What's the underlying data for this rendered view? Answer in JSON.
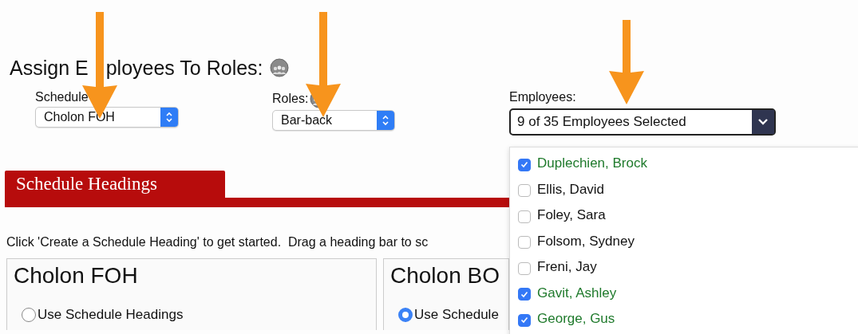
{
  "title": [
    "Assign E",
    "ployees To Roles:"
  ],
  "schedule": {
    "label": "Schedule",
    "value": "Cholon FOH"
  },
  "roles": {
    "label": "Roles:",
    "value": "Bar-back"
  },
  "employees": {
    "label": "Employees:",
    "value": "9 of 35 Employees Selected",
    "expanded": true,
    "options": [
      {
        "name": "Duplechien, Brock",
        "checked": true
      },
      {
        "name": "Ellis, David",
        "checked": false
      },
      {
        "name": "Foley, Sara",
        "checked": false
      },
      {
        "name": "Folsom, Sydney",
        "checked": false
      },
      {
        "name": "Freni, Jay",
        "checked": false
      },
      {
        "name": "Gavit, Ashley",
        "checked": true
      },
      {
        "name": "George, Gus",
        "checked": true
      }
    ]
  },
  "section_tab": "Schedule Headings",
  "instructions": "Click 'Create a Schedule Heading' to get started.  Drag a heading bar to sc",
  "panels": [
    {
      "title": "Cholon FOH",
      "option": {
        "label": "Use Schedule Headings",
        "selected": false
      }
    },
    {
      "title": "Cholon BO",
      "option": {
        "label": "Use Schedule",
        "selected": true
      }
    }
  ]
}
